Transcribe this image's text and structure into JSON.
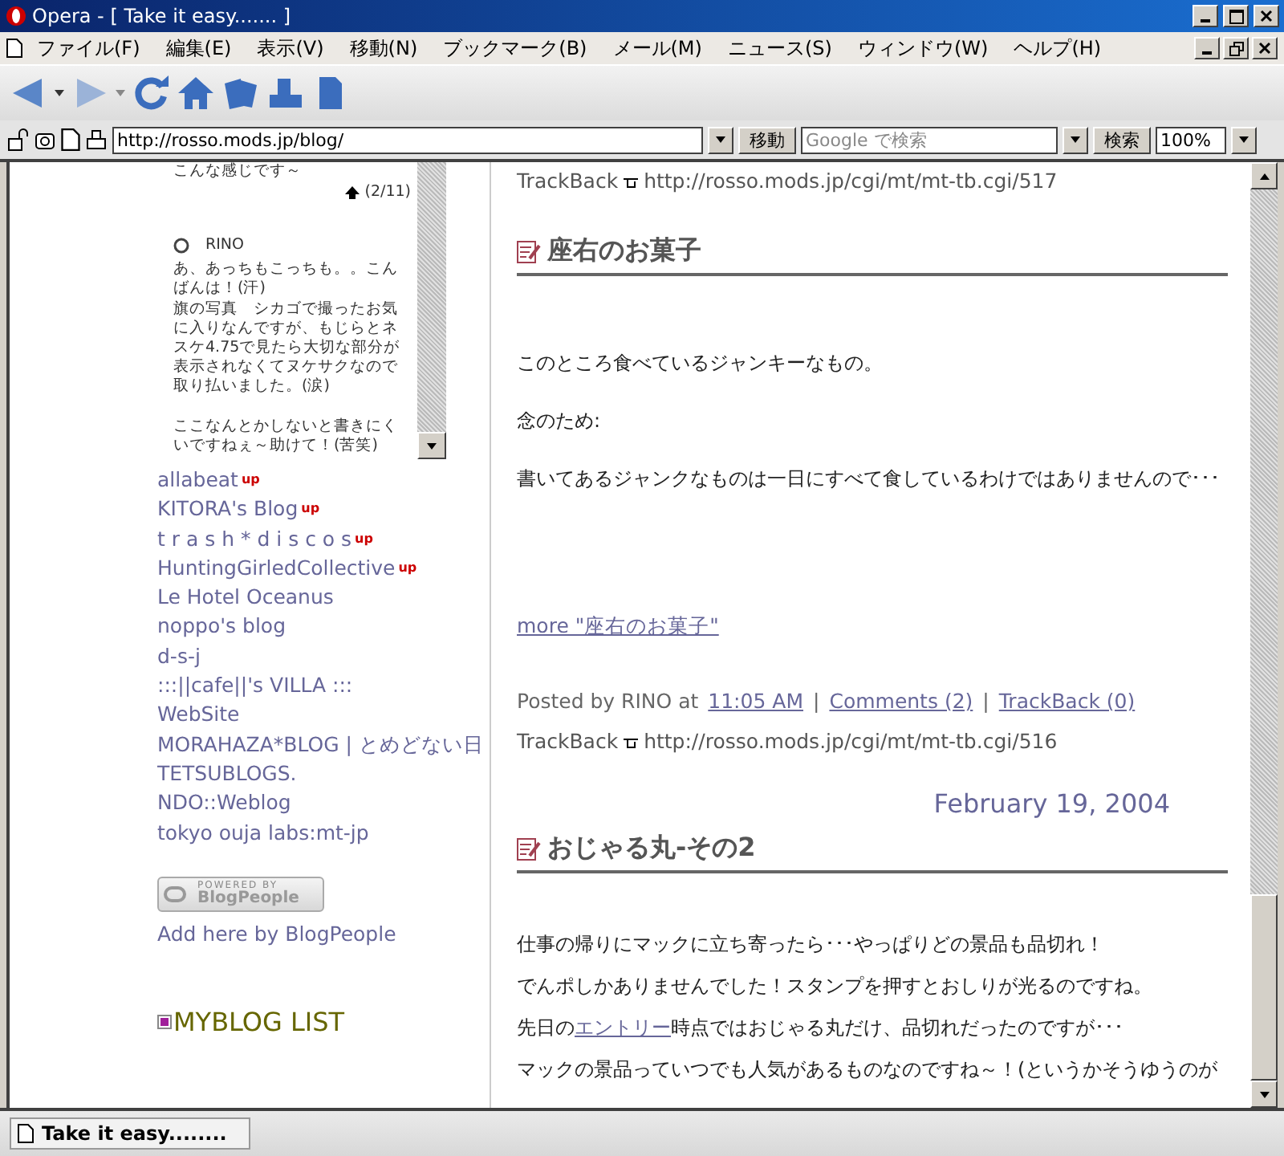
{
  "window": {
    "title": "Opera - [ Take it easy....... ]"
  },
  "menu": [
    "ファイル(F)",
    "編集(E)",
    "表示(V)",
    "移動(N)",
    "ブックマーク(B)",
    "メール(M)",
    "ニュース(S)",
    "ウィンドウ(W)",
    "ヘルプ(H)"
  ],
  "address_bar": {
    "url": "http://rosso.mods.jp/blog/",
    "go_button": "移動",
    "search_placeholder": "Google で検索",
    "search_button": "検索",
    "zoom": "100%"
  },
  "sidebar": {
    "comments_box": {
      "top_line": "こんな感じです～",
      "page_counter": "(2/11)",
      "author": "RINO",
      "body": [
        "あ、あっちもこっちも。。こんばんは！(汗)",
        "旗の写真　シカゴで撮ったお気に入りなんですが、もじらとネスケ4.75で見たら大切な部分が表示されなくてヌケサクなので取り払いました。(涙)",
        "ここなんとかしないと書きにくいですねぇ～助けて！(苦笑)"
      ]
    },
    "links": [
      {
        "label": "allabeat",
        "badge": "up"
      },
      {
        "label": "KITORA's Blog",
        "badge": "up"
      },
      {
        "label": "t r a s h * d i s c o s",
        "badge": "up"
      },
      {
        "label": "HuntingGirledCollective",
        "badge": "up"
      },
      {
        "label": "Le Hotel Oceanus"
      },
      {
        "label": "noppo's blog"
      },
      {
        "label": "d-s-j"
      },
      {
        "label": ":::||cafe||'s VILLA :::"
      },
      {
        "label": "WebSite"
      },
      {
        "label": "MORAHAZA*BLOG | とめどない日"
      },
      {
        "label": "TETSUBLOGS."
      },
      {
        "label": "NDO::Weblog"
      },
      {
        "label": "tokyo ouja labs:mt-jp"
      }
    ],
    "badge_banner": {
      "top": "POWERED BY",
      "name": "BlogPeople"
    },
    "add_link": "Add here by BlogPeople",
    "section_title": "MYBLOG LIST"
  },
  "main": {
    "entries": [
      {
        "trackback_label": "TrackBack",
        "trackback_url": "http://rosso.mods.jp/cgi/mt/mt-tb.cgi/517"
      },
      {
        "title": "座右のお菓子",
        "paragraphs": [
          [
            {
              "text": "このところ食べているジャンキーなもの。",
              "kind": "text"
            }
          ],
          [
            {
              "text": "念のため:",
              "kind": "text"
            }
          ],
          [
            {
              "text": "書いてあるジャンクなものは一日にすべて食しているわけではありませんので･･･",
              "kind": "text"
            }
          ]
        ],
        "more": "more \"座右のお菓子\"",
        "posted_by": "Posted by RINO at",
        "time": "11:05 AM",
        "separators": [
          "|",
          "|"
        ],
        "comments": "Comments (2)",
        "trackbacks": "TrackBack (0)",
        "trackback_label": "TrackBack",
        "trackback_url": "http://rosso.mods.jp/cgi/mt/mt-tb.cgi/516"
      },
      {
        "date": "February 19, 2004",
        "title": "おじゃる丸-その2",
        "paragraphs": [
          [
            {
              "text": "仕事の帰りにマックに立ち寄ったら･･･やっぱりどの景品も品切れ！",
              "kind": "text"
            }
          ],
          [
            {
              "text": "でんポしかありませんでした！スタンプを押すとおしりが光るのですね。",
              "kind": "text"
            }
          ],
          [
            {
              "text": "先日の",
              "kind": "text"
            },
            {
              "text": "エントリー",
              "kind": "link"
            },
            {
              "text": "時点ではおじゃる丸だけ、品切れだったのですが･･･",
              "kind": "text"
            }
          ],
          [
            {
              "text": "マックの景品っていつでも人気があるものなのですね～！(というかそうゆうのが",
              "kind": "text"
            }
          ]
        ]
      }
    ]
  },
  "status_bar": {
    "text": "Take it easy........"
  }
}
